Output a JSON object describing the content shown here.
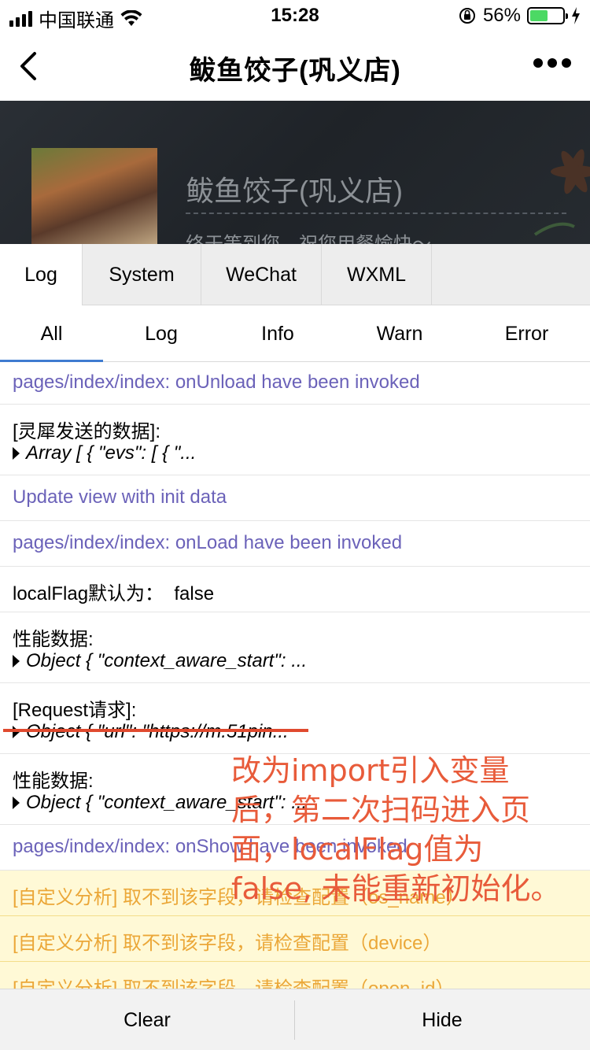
{
  "status_bar": {
    "carrier": "中国联通",
    "time": "15:28",
    "battery_percent": "56%",
    "battery_level": 0.56,
    "signal_bars": 4
  },
  "nav": {
    "title": "鲅鱼饺子(巩义店)"
  },
  "header": {
    "shop_name": "鲅鱼饺子(巩义店)",
    "welcome": "终于等到您，祝您用餐愉快～"
  },
  "console": {
    "main_tabs": [
      "Log",
      "System",
      "WeChat",
      "WXML"
    ],
    "sub_tabs": [
      "All",
      "Log",
      "Info",
      "Warn",
      "Error"
    ],
    "logs": {
      "unload": "pages/index/index: onUnload have been invoked",
      "lingxi_label": "[灵犀发送的数据]:",
      "lingxi_obj": "Array [ { \"evs\": [ { \"...",
      "update_view": "Update view with init data",
      "onload": "pages/index/index: onLoad have been invoked",
      "local_flag": "localFlag默认为：  false",
      "perf_label_1": "性能数据:",
      "perf_obj_1": "Object { \"context_aware_start\": ...",
      "request_label": "[Request请求]:",
      "request_obj": "Object { \"url\": \"https://m.51pin...",
      "perf_label_2": "性能数据:",
      "perf_obj_2": "Object { \"context_aware_start\": ...",
      "onshow": "pages/index/index: onShow have been invoked",
      "warn_os_name": "[自定义分析] 取不到该字段，请检查配置（os_name）",
      "warn_device": "[自定义分析] 取不到该字段，请检查配置（device）",
      "warn_open_id": "[自定义分析] 取不到该字段，请检查配置（open_id）"
    },
    "annotation": "改为import引入变量后，第二次扫码进入页面，localFlag值为false, 未能重新初始化。",
    "bottom": {
      "clear": "Clear",
      "hide": "Hide"
    }
  },
  "colors": {
    "info_text": "#6b62b9",
    "warn_text": "#eba738",
    "warn_bg": "#fff9d6",
    "annotation": "#e85b3a",
    "active_tab_underline": "#3e7bd0",
    "battery_fill": "#4cd964"
  },
  "icons": [
    "signal-icon",
    "wifi-icon",
    "orientation-lock-icon",
    "battery-icon",
    "charging-icon",
    "back-arrow-icon",
    "more-icon"
  ]
}
